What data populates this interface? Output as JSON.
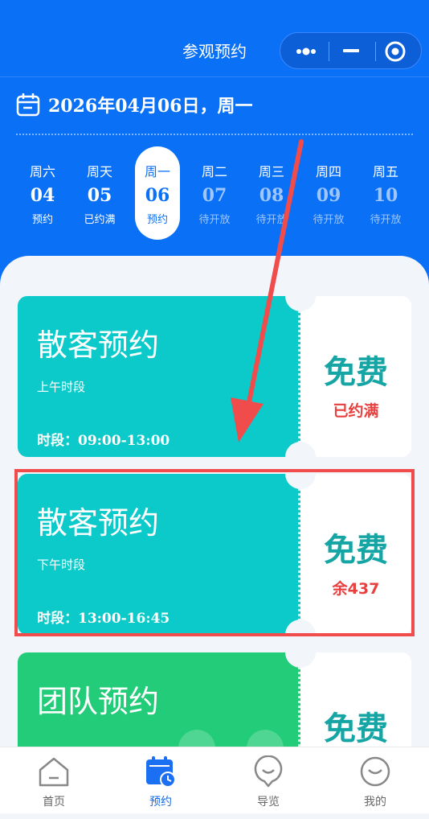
{
  "header": {
    "title": "参观预约"
  },
  "date": {
    "text": "2026年04月06日，周一"
  },
  "days": [
    {
      "weekday": "周六",
      "day": "04",
      "status": "预约"
    },
    {
      "weekday": "周天",
      "day": "05",
      "status": "已约满"
    },
    {
      "weekday": "周一",
      "day": "06",
      "status": "预约"
    },
    {
      "weekday": "周二",
      "day": "07",
      "status": "待开放"
    },
    {
      "weekday": "周三",
      "day": "08",
      "status": "待开放"
    },
    {
      "weekday": "周四",
      "day": "09",
      "status": "待开放"
    },
    {
      "weekday": "周五",
      "day": "10",
      "status": "待开放"
    }
  ],
  "cards": [
    {
      "title": "散客预约",
      "subtitle": "上午时段",
      "time_label": "时段：",
      "time": "09:00-13:00",
      "price": "免费",
      "status": "已约满",
      "color": "#0ccaca"
    },
    {
      "title": "散客预约",
      "subtitle": "下午时段",
      "time_label": "时段：",
      "time": "13:00-16:45",
      "price": "免费",
      "status": "余437",
      "color": "#0ccaca"
    },
    {
      "title": "团队预约",
      "price": "免费",
      "color": "#23cc78"
    }
  ],
  "tabs": [
    {
      "label": "首页",
      "icon": "home-icon"
    },
    {
      "label": "预约",
      "icon": "calendar-clock-icon",
      "active": true
    },
    {
      "label": "导览",
      "icon": "guide-icon"
    },
    {
      "label": "我的",
      "icon": "profile-icon"
    }
  ],
  "colors": {
    "primary": "#0a70f5",
    "teal": "#0ccaca",
    "green": "#23cc78",
    "alert": "#e8403f",
    "highlight": "#f14c4c"
  }
}
